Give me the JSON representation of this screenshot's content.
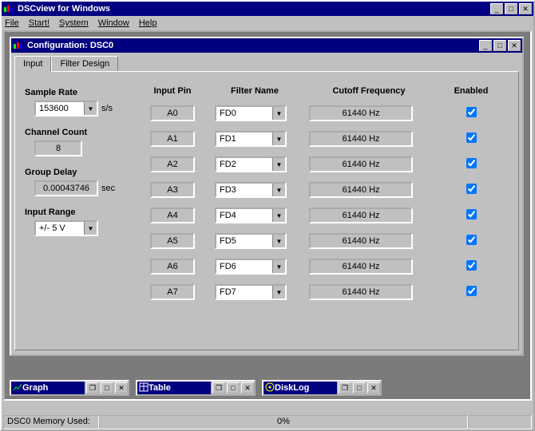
{
  "app": {
    "title": "DSCview for Windows",
    "menu": [
      "File",
      "Start!",
      "System",
      "Window",
      "Help"
    ]
  },
  "config_window": {
    "title": "Configuration: DSC0",
    "tabs": {
      "input": "Input",
      "filter_design": "Filter Design"
    },
    "params": {
      "sample_rate_label": "Sample Rate",
      "sample_rate_value": "153600",
      "sample_rate_unit": "s/s",
      "channel_count_label": "Channel Count",
      "channel_count_value": "8",
      "group_delay_label": "Group Delay",
      "group_delay_value": "0.00043746",
      "group_delay_unit": "sec",
      "input_range_label": "Input Range",
      "input_range_value": "+/- 5 V"
    },
    "grid_headers": {
      "pin": "Input Pin",
      "filter": "Filter Name",
      "cutoff": "Cutoff Frequency",
      "enabled": "Enabled"
    },
    "rows": [
      {
        "pin": "A0",
        "filter": "FD0",
        "cutoff": "61440 Hz",
        "enabled": true
      },
      {
        "pin": "A1",
        "filter": "FD1",
        "cutoff": "61440 Hz",
        "enabled": true
      },
      {
        "pin": "A2",
        "filter": "FD2",
        "cutoff": "61440 Hz",
        "enabled": true
      },
      {
        "pin": "A3",
        "filter": "FD3",
        "cutoff": "61440 Hz",
        "enabled": true
      },
      {
        "pin": "A4",
        "filter": "FD4",
        "cutoff": "61440 Hz",
        "enabled": true
      },
      {
        "pin": "A5",
        "filter": "FD5",
        "cutoff": "61440 Hz",
        "enabled": true
      },
      {
        "pin": "A6",
        "filter": "FD6",
        "cutoff": "61440 Hz",
        "enabled": true
      },
      {
        "pin": "A7",
        "filter": "FD7",
        "cutoff": "61440 Hz",
        "enabled": true
      }
    ]
  },
  "minimized_windows": {
    "graph": "Graph",
    "table": "Table",
    "disklog": "DiskLog"
  },
  "status": {
    "mem_label": "DSC0 Memory Used:",
    "mem_value": "0%"
  },
  "glyphs": {
    "down": "▼",
    "min": "_",
    "max": "□",
    "restore": "❐",
    "close": "✕",
    "check": "✓"
  }
}
